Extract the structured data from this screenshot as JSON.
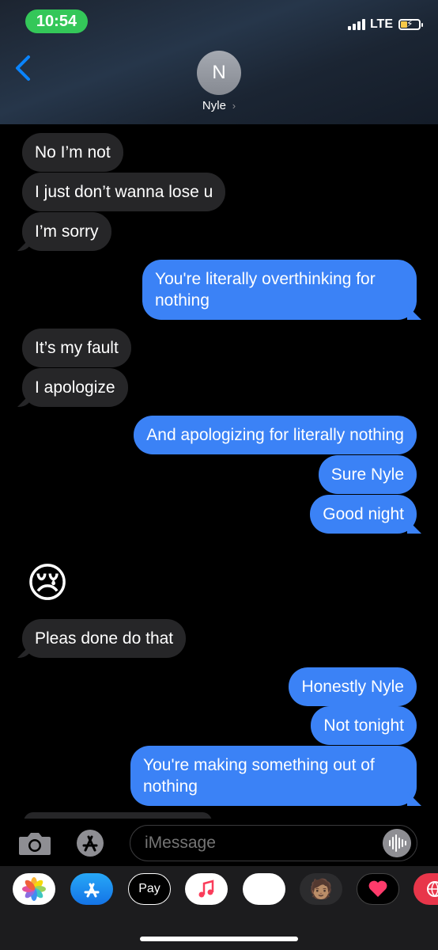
{
  "status": {
    "time": "10:54",
    "network": "LTE"
  },
  "header": {
    "contact_initial": "N",
    "contact_name": "Nyle"
  },
  "messages": [
    {
      "dir": "in",
      "text": "No I’m not"
    },
    {
      "dir": "in",
      "text": "I just don’t wanna lose u"
    },
    {
      "dir": "in",
      "text": "I’m sorry"
    },
    {
      "dir": "out",
      "text": "You're literally overthinking for nothing"
    },
    {
      "dir": "in",
      "text": "It’s my fault"
    },
    {
      "dir": "in",
      "text": "I apologize"
    },
    {
      "dir": "out",
      "text": "And apologizing for literally nothing"
    },
    {
      "dir": "out",
      "text": "Sure Nyle"
    },
    {
      "dir": "out",
      "text": "Good night"
    },
    {
      "dir": "in",
      "text": "😢"
    },
    {
      "dir": "in",
      "text": "Pleas done do that"
    },
    {
      "dir": "out",
      "text": "Honestly Nyle"
    },
    {
      "dir": "out",
      "text": "Not tonight"
    },
    {
      "dir": "out",
      "text": "You're making something out of nothing"
    }
  ],
  "composer": {
    "placeholder": "iMessage"
  },
  "app_drawer": {
    "apps": [
      {
        "name": "photos-app",
        "label": ""
      },
      {
        "name": "app-store-app",
        "label": ""
      },
      {
        "name": "apple-pay-app",
        "label": "Pay"
      },
      {
        "name": "music-app",
        "label": ""
      },
      {
        "name": "animoji-app",
        "label": ""
      },
      {
        "name": "memoji-stickers-app",
        "label": ""
      },
      {
        "name": "digital-touch-app",
        "label": ""
      },
      {
        "name": "web-search-app",
        "label": ""
      }
    ]
  },
  "colors": {
    "outgoing": "#3b82f6",
    "incoming": "#262628",
    "time_pill": "#34c759",
    "accent": "#0a84ff"
  }
}
